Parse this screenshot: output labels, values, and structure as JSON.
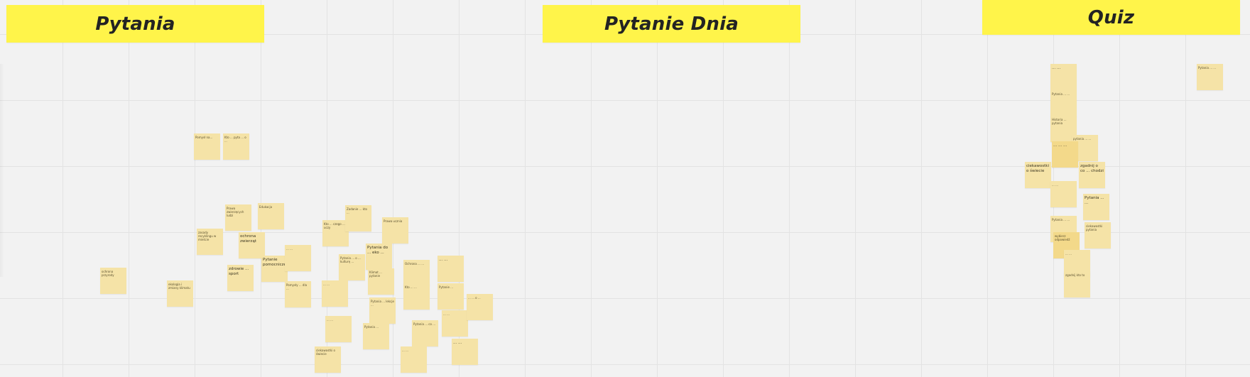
{
  "board": {
    "frames": [
      {
        "title": "Pytania"
      },
      {
        "title": "Pytanie Dnia"
      },
      {
        "title": "Quiz"
      }
    ]
  },
  "stickies": [
    {
      "text": "Pomysł na..."
    },
    {
      "text": "Kto ... pyta ... o ..."
    },
    {
      "text": "ochrona przyrody"
    },
    {
      "text": "ekologia i zmiany klimatu"
    },
    {
      "text": "zasady recyklingu w mieście"
    },
    {
      "text": "Prawa zwierzęcych ludzi"
    },
    {
      "text": "Edukacja"
    },
    {
      "text": "ochrona zwierząt"
    },
    {
      "text": "zdrowie ... sport"
    },
    {
      "text": "Pytanie pomocnicze"
    },
    {
      "text": "... ..."
    },
    {
      "text": "Pomysły ... dla ..."
    },
    {
      "text": "Kto ... czego ... uczy"
    },
    {
      "text": "Zadanie ... kto ..."
    },
    {
      "text": "Prawa ucznia"
    },
    {
      "text": "Pytania do ... eko ..."
    },
    {
      "text": "Pytania ... o ... kulturę ..."
    },
    {
      "text": "Klimat ... pytanie"
    },
    {
      "text": "... ..."
    },
    {
      "text": "Ochrona ... ..."
    },
    {
      "text": "... ..."
    },
    {
      "text": "Kto ... ..."
    },
    {
      "text": "Pytanie ..."
    },
    {
      "text": "Pytania ... lekcje ..."
    },
    {
      "text": "... ..."
    },
    {
      "text": "Pytania ..."
    },
    {
      "text": "Pytania ... co ..."
    },
    {
      "text": "... ..."
    },
    {
      "text": "... ... o ..."
    },
    {
      "text": "... ..."
    },
    {
      "text": "ciekawostki o świecie"
    },
    {
      "text": "... ..."
    },
    {
      "text": "... ..."
    },
    {
      "text": "Pytania ... ..."
    },
    {
      "text": "Historia ... pytania"
    },
    {
      "text": "pytania ... ..."
    },
    {
      "text": "... ... ..."
    },
    {
      "text": "ciekawostki o świecie"
    },
    {
      "text": "zgadnij o co ... chodzi"
    },
    {
      "text": "... ..."
    },
    {
      "text": "Pytania ... ..."
    },
    {
      "text": "Pytania ... ..."
    },
    {
      "text": "wybierz odpowiedź"
    },
    {
      "text": "ciekawostki pytania"
    },
    {
      "text": "... ..."
    },
    {
      "text": "zgadnij kto to"
    },
    {
      "text": "Pytania ... ..."
    },
    {
      "text": "... ..."
    },
    {
      "text": "... ..."
    },
    {
      "text": "pytania zamknięte"
    },
    {
      "text": "... ..."
    },
    {
      "text": "... ..."
    },
    {
      "text": "... ..."
    }
  ]
}
